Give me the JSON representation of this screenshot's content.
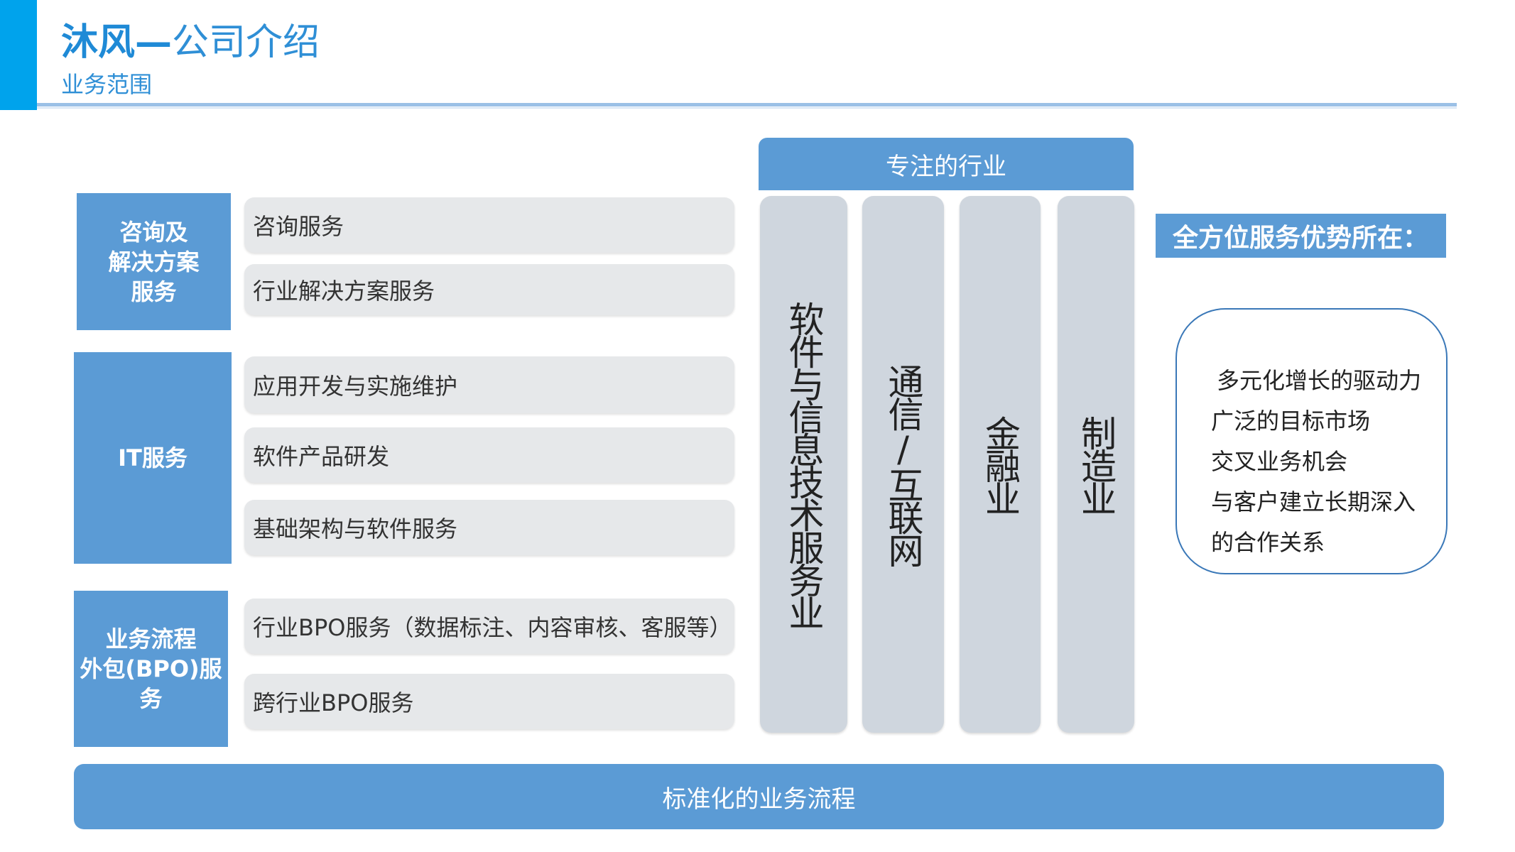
{
  "header": {
    "brand": "沐风",
    "dash": "—",
    "title_rest": "公司介绍",
    "subtitle": "业务范围"
  },
  "categories": [
    {
      "lines": [
        "咨询及",
        "解决方案",
        "服务"
      ],
      "services": [
        "咨询服务",
        "行业解决方案服务"
      ]
    },
    {
      "lines": [
        "IT服务"
      ],
      "services": [
        "应用开发与实施维护",
        "软件产品研发",
        "基础架构与软件服务"
      ]
    },
    {
      "lines": [
        "业务流程",
        "外包(BPO)服",
        "务"
      ],
      "services": [
        "行业BPO服务（数据标注、内容审核、客服等）",
        "跨行业BPO服务"
      ]
    }
  ],
  "industries": {
    "header": "专注的行业",
    "items": [
      "软件与信息技术服务业",
      "通信/互联网",
      "金融业",
      "制造业"
    ]
  },
  "advantages": {
    "header": "全方位服务优势所在：",
    "items": [
      "多元化增长的驱动力",
      "广泛的目标市场",
      "交叉业务机会",
      "与客户建立长期深入",
      "的合作关系"
    ]
  },
  "footer": {
    "label": "标准化的业务流程"
  },
  "colors": {
    "primary": "#5b9bd5",
    "accent": "#00a3ec",
    "pill": "#e6e8ea",
    "column": "#cfd6de"
  }
}
